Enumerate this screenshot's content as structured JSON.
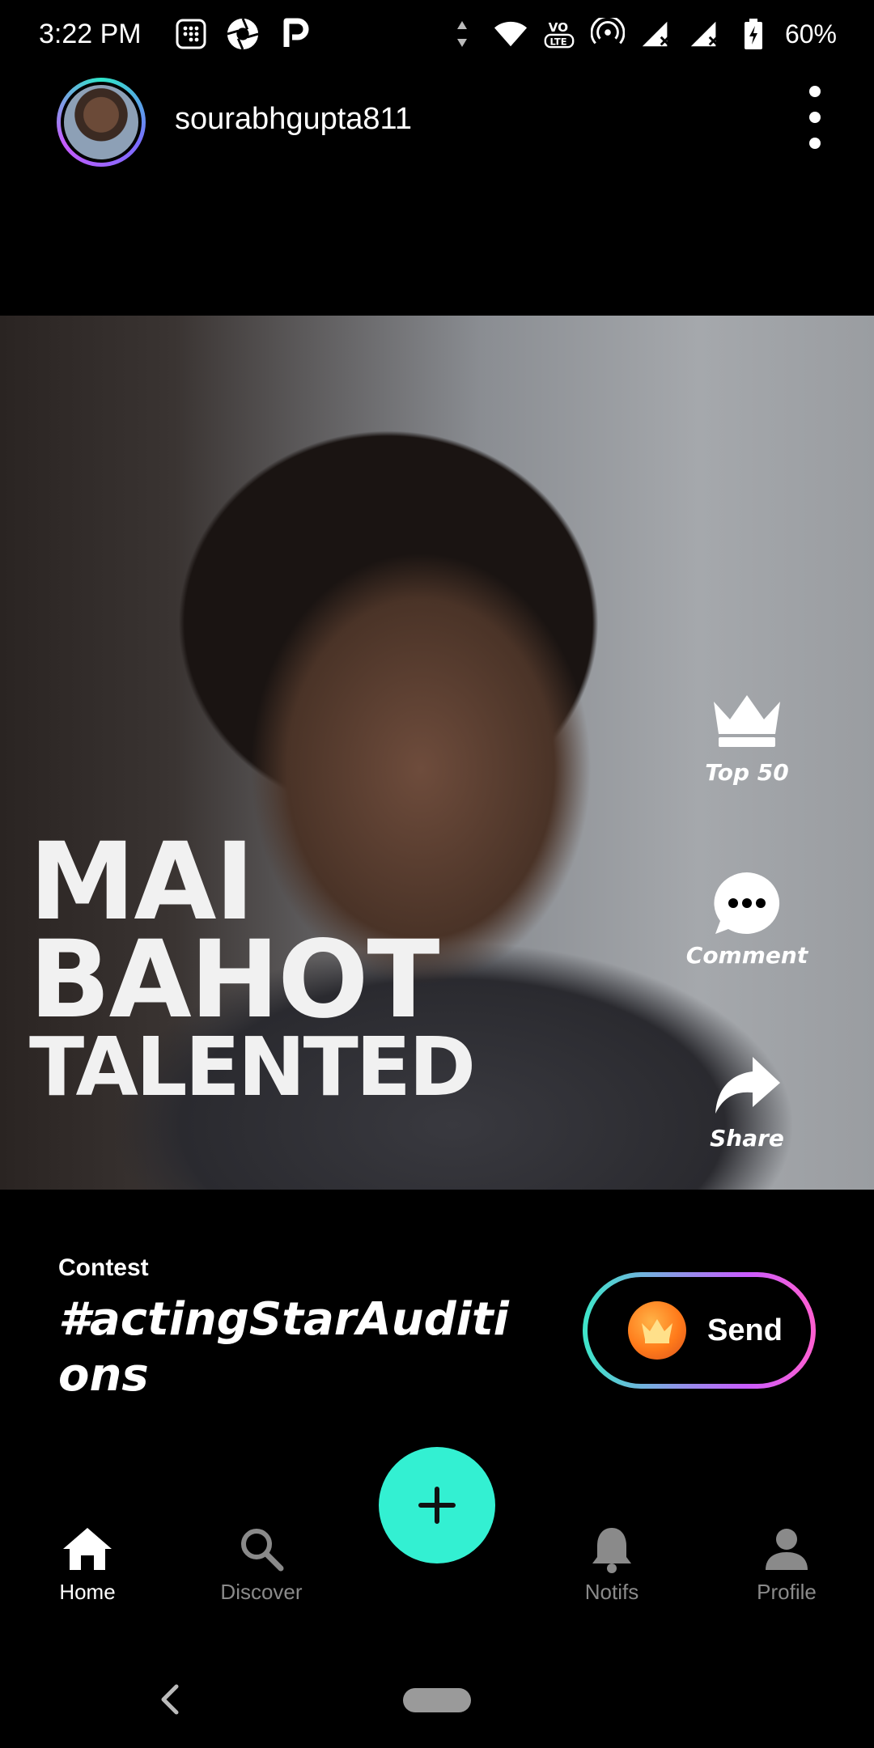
{
  "status_bar": {
    "time": "3:22 PM",
    "battery": "60%",
    "icons": [
      "calculator-icon",
      "shutter-icon",
      "p-app-icon",
      "data-arrows-icon",
      "wifi-icon",
      "volte-icon",
      "hotspot-icon",
      "signal-icon",
      "signal-icon",
      "battery-icon"
    ]
  },
  "header": {
    "username": "sourabhgupta811"
  },
  "video": {
    "overlay_lines": [
      "MAI",
      "BAHOT",
      "TALENTED"
    ]
  },
  "actions": {
    "top50": "Top 50",
    "comment": "Comment",
    "share": "Share"
  },
  "contest": {
    "label": "Contest",
    "title": "#actingStarAuditions",
    "send_label": "Send"
  },
  "nav": {
    "home": "Home",
    "discover": "Discover",
    "notifs": "Notifs",
    "profile": "Profile"
  },
  "colors": {
    "accent": "#33f0d2",
    "gradient_start": "#3de6c9",
    "gradient_end": "#ff5fd0"
  }
}
